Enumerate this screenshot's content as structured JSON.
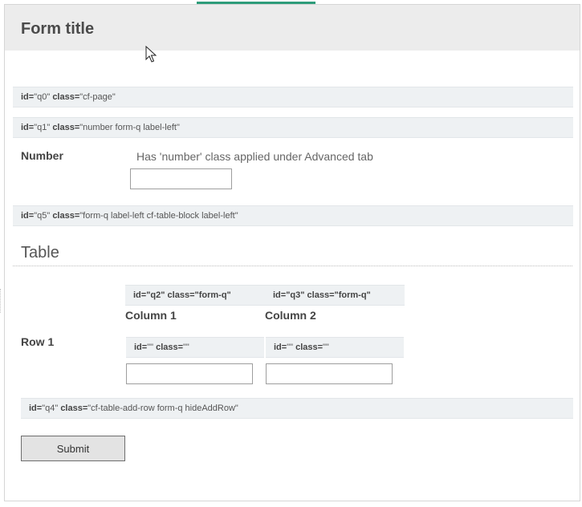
{
  "form": {
    "title": "Form title"
  },
  "page_info": {
    "id_key": "id=",
    "id_val": "\"q0\"",
    "class_key": "class=",
    "class_val": "\"cf-page\""
  },
  "number_info": {
    "id_key": "id=",
    "id_val": "\"q1\"",
    "class_key": "class=",
    "class_val": "\"number form-q label-left\""
  },
  "number_field": {
    "label": "Number",
    "help": "Has 'number' class applied under Advanced tab",
    "value": "",
    "placeholder": ""
  },
  "table_info": {
    "id_key": "id=",
    "id_val": "\"q5\"",
    "class_key": "class=",
    "class_val": "\"form-q label-left cf-table-block label-left\""
  },
  "table": {
    "title": "Table",
    "columns": [
      {
        "id_key": "id=",
        "id_val": "\"q2\"",
        "class_key": "class=",
        "class_val": "\"form-q\"",
        "label": "Column 1"
      },
      {
        "id_key": "id=",
        "id_val": "\"q3\"",
        "class_key": "class=",
        "class_val": "\"form-q\"",
        "label": "Column 2"
      }
    ],
    "rows": [
      {
        "label": "Row 1",
        "cells": [
          {
            "id_key": "id=",
            "id_val": "\"\"",
            "class_key": "class=",
            "class_val": "\"\"",
            "value": ""
          },
          {
            "id_key": "id=",
            "id_val": "\"\"",
            "class_key": "class=",
            "class_val": "\"\"",
            "value": ""
          }
        ]
      }
    ]
  },
  "add_row_info": {
    "id_key": "id=",
    "id_val": "\"q4\"",
    "class_key": "class=",
    "class_val": "\"cf-table-add-row form-q hideAddRow\""
  },
  "actions": {
    "submit_label": "Submit"
  },
  "colors": {
    "accent": "#2e9c7a",
    "header_bg": "#ececec",
    "info_bar_bg": "#eef1f3"
  },
  "icons": {
    "cursor": "mouse-pointer-icon"
  }
}
